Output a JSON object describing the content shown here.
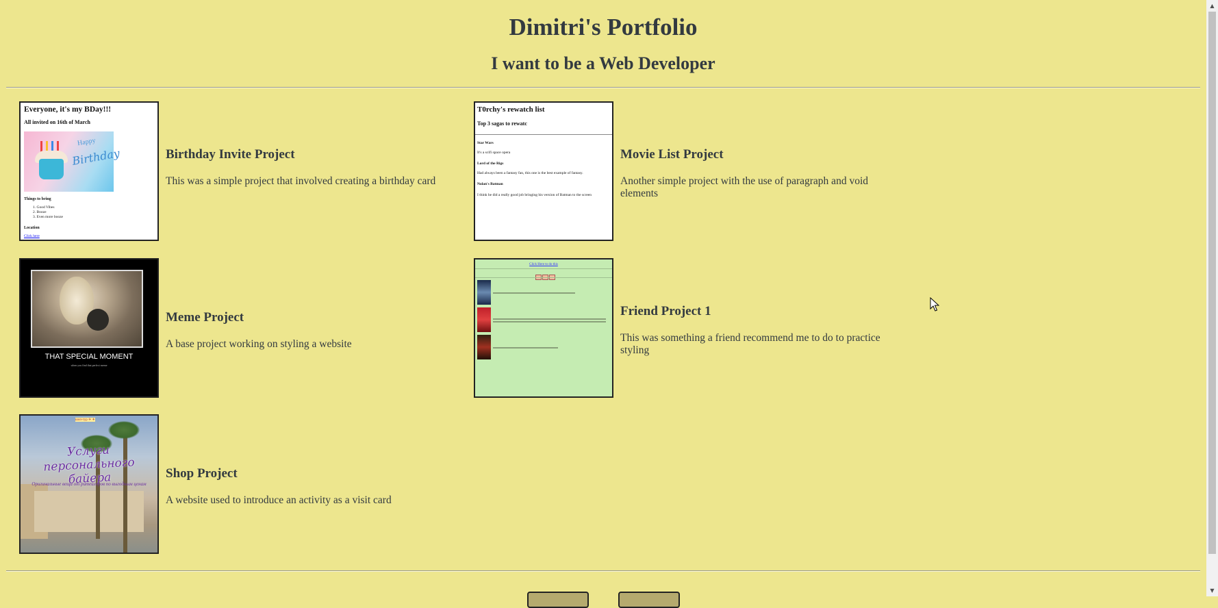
{
  "header": {
    "title": "Dimitri's Portfolio",
    "subtitle": "I want to be a Web Developer"
  },
  "projects": [
    {
      "title": "Birthday Invite Project",
      "description": "This was a simple project that involved creating a birthday card",
      "thumb": {
        "heading": "Everyone, it's my BDay!!!",
        "subheading": "All invited on 16th of March",
        "things_heading": "Things to bring",
        "items": [
          "Good Vibes",
          "Booze",
          "Even more booze"
        ],
        "location_heading": "Location",
        "link": "Click here",
        "image_text_1": "Happy",
        "image_text_2": "Birthday"
      }
    },
    {
      "title": "Movie List Project",
      "description": "Another simple project with the use of paragraph and void elements",
      "thumb": {
        "heading": "T0rchy's rewatch list",
        "subheading": "Top 3 sagas to rewatc",
        "entries": [
          {
            "name": "Star Wars",
            "text": "It's a scifi space opera"
          },
          {
            "name": "Lord of the Rigs",
            "text": "Had always been a fantasy fan, this one is the best example of fantasy."
          },
          {
            "name": "Nolan's Batman",
            "text": "I think he did a really good job bringing his version of Batman to the screen"
          }
        ]
      }
    },
    {
      "title": "Meme Project",
      "description": "A base project working on styling a website",
      "thumb": {
        "caption": "THAT SPECIAL MOMENT",
        "subcaption": "when you find that perfect meme"
      }
    },
    {
      "title": "Friend Project 1",
      "description": "This was something a friend recommend me to do to practice styling",
      "thumb": {
        "link": "Click Here to do this"
      }
    },
    {
      "title": "Shop Project",
      "description": "A website used to introduce an activity as a visit card",
      "thumb": {
        "title": "Услуги персонального байера",
        "subtitle": "Оригинальные вещи от ритейлеров по выгодным ценам",
        "top": "шоп-тур ✈ ✈"
      }
    }
  ],
  "colors": {
    "background": "#ede68e",
    "text": "#333a40",
    "button": "#b5aa6e"
  }
}
